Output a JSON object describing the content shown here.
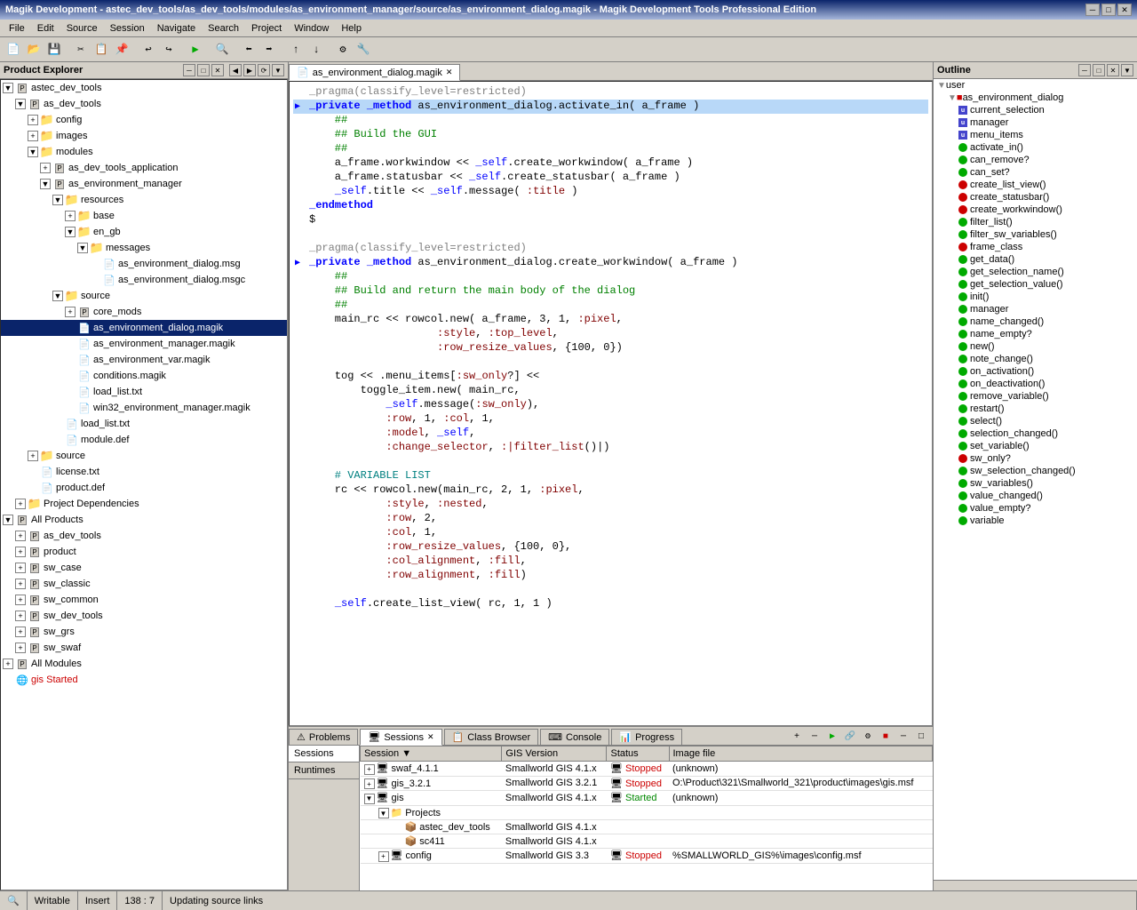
{
  "titleBar": {
    "title": "Magik Development - astec_dev_tools/as_dev_tools/modules/as_environment_manager/source/as_environment_dialog.magik - Magik Development Tools Professional Edition",
    "winBtns": [
      "─",
      "□",
      "✕"
    ]
  },
  "menuBar": {
    "items": [
      "File",
      "Edit",
      "Source",
      "Session",
      "Navigate",
      "Search",
      "Project",
      "Window",
      "Help"
    ]
  },
  "leftPanel": {
    "title": "Product Explorer",
    "tree": [
      {
        "label": "astec_dev_tools",
        "level": 0,
        "expand": "▼",
        "type": "pkg",
        "color": "#d4d0c8"
      },
      {
        "label": "as_dev_tools",
        "level": 1,
        "expand": "▼",
        "type": "pkg"
      },
      {
        "label": "config",
        "level": 2,
        "expand": "+",
        "type": "folder"
      },
      {
        "label": "images",
        "level": 2,
        "expand": "+",
        "type": "folder"
      },
      {
        "label": "modules",
        "level": 2,
        "expand": "▼",
        "type": "folder"
      },
      {
        "label": "as_dev_tools_application",
        "level": 3,
        "expand": "+",
        "type": "pkg"
      },
      {
        "label": "as_environment_manager",
        "level": 3,
        "expand": "▼",
        "type": "pkg"
      },
      {
        "label": "resources",
        "level": 4,
        "expand": "▼",
        "type": "folder"
      },
      {
        "label": "base",
        "level": 5,
        "expand": "+",
        "type": "folder"
      },
      {
        "label": "en_gb",
        "level": 5,
        "expand": "▼",
        "type": "folder"
      },
      {
        "label": "messages",
        "level": 6,
        "expand": "▼",
        "type": "folder"
      },
      {
        "label": "as_environment_dialog.msg",
        "level": 7,
        "expand": null,
        "type": "file"
      },
      {
        "label": "as_environment_dialog.msgc",
        "level": 7,
        "expand": null,
        "type": "file"
      },
      {
        "label": "source",
        "level": 4,
        "expand": "▼",
        "type": "folder"
      },
      {
        "label": "core_mods",
        "level": 5,
        "expand": "+",
        "type": "pkg"
      },
      {
        "label": "as_environment_dialog.magik",
        "level": 5,
        "expand": null,
        "type": "file",
        "selected": true
      },
      {
        "label": "as_environment_manager.magik",
        "level": 5,
        "expand": null,
        "type": "file"
      },
      {
        "label": "as_environment_var.magik",
        "level": 5,
        "expand": null,
        "type": "file"
      },
      {
        "label": "conditions.magik",
        "level": 5,
        "expand": null,
        "type": "file"
      },
      {
        "label": "load_list.txt",
        "level": 5,
        "expand": null,
        "type": "file"
      },
      {
        "label": "win32_environment_manager.magik",
        "level": 5,
        "expand": null,
        "type": "file"
      },
      {
        "label": "load_list.txt",
        "level": 4,
        "expand": null,
        "type": "file"
      },
      {
        "label": "module.def",
        "level": 4,
        "expand": null,
        "type": "file"
      },
      {
        "label": "source",
        "level": 2,
        "expand": "+",
        "type": "folder"
      },
      {
        "label": "license.txt",
        "level": 2,
        "expand": null,
        "type": "file"
      },
      {
        "label": "product.def",
        "level": 2,
        "expand": null,
        "type": "file"
      },
      {
        "label": "Project Dependencies",
        "level": 1,
        "expand": "+",
        "type": "folder"
      },
      {
        "label": "All Products",
        "level": 0,
        "expand": "▼",
        "type": "pkg"
      },
      {
        "label": "as_dev_tools",
        "level": 1,
        "expand": "+",
        "type": "pkg"
      },
      {
        "label": "product",
        "level": 1,
        "expand": "+",
        "type": "pkg"
      },
      {
        "label": "sw_case",
        "level": 1,
        "expand": "+",
        "type": "pkg"
      },
      {
        "label": "sw_classic",
        "level": 1,
        "expand": "+",
        "type": "pkg"
      },
      {
        "label": "sw_common",
        "level": 1,
        "expand": "+",
        "type": "pkg"
      },
      {
        "label": "sw_dev_tools",
        "level": 1,
        "expand": "+",
        "type": "pkg"
      },
      {
        "label": "sw_grs",
        "level": 1,
        "expand": "+",
        "type": "pkg"
      },
      {
        "label": "sw_swaf",
        "level": 1,
        "expand": "+",
        "type": "pkg"
      },
      {
        "label": "All Modules",
        "level": 0,
        "expand": "+",
        "type": "pkg"
      },
      {
        "label": "gis Started",
        "level": 0,
        "expand": null,
        "type": "gis"
      }
    ]
  },
  "editorTab": {
    "label": "as_environment_dialog.magik",
    "closeBtn": "✕"
  },
  "codeLines": [
    {
      "text": "_pragma(classify_level=restricted)",
      "type": "pragma",
      "arrow": false,
      "highlighted": false
    },
    {
      "text": "_private _method as_environment_dialog.activate_in( a_frame )",
      "type": "method",
      "arrow": true,
      "highlighted": true
    },
    {
      "text": "    ##",
      "type": "comment",
      "arrow": false,
      "highlighted": false
    },
    {
      "text": "    ## Build the GUI",
      "type": "comment",
      "arrow": false,
      "highlighted": false
    },
    {
      "text": "    ##",
      "type": "comment",
      "arrow": false,
      "highlighted": false
    },
    {
      "text": "    a_frame.workwindow << _self.create_workwindow( a_frame )",
      "type": "code",
      "arrow": false,
      "highlighted": false
    },
    {
      "text": "    a_frame.statusbar << _self.create_statusbar( a_frame )",
      "type": "code",
      "arrow": false,
      "highlighted": false
    },
    {
      "text": "    _self.title << _self.message( :title )",
      "type": "code",
      "arrow": false,
      "highlighted": false
    },
    {
      "text": "_endmethod",
      "type": "endmethod",
      "arrow": false,
      "highlighted": false
    },
    {
      "text": "$",
      "type": "code",
      "arrow": false,
      "highlighted": false
    },
    {
      "text": "",
      "type": "code",
      "arrow": false,
      "highlighted": false
    },
    {
      "text": "_pragma(classify_level=restricted)",
      "type": "pragma",
      "arrow": false,
      "highlighted": false
    },
    {
      "text": "_private _method as_environment_dialog.create_workwindow( a_frame )",
      "type": "method",
      "arrow": true,
      "highlighted": false
    },
    {
      "text": "    ##",
      "type": "comment",
      "arrow": false,
      "highlighted": false
    },
    {
      "text": "    ## Build and return the main body of the dialog",
      "type": "comment",
      "arrow": false,
      "highlighted": false
    },
    {
      "text": "    ##",
      "type": "comment",
      "arrow": false,
      "highlighted": false
    },
    {
      "text": "    main_rc << rowcol.new( a_frame, 3, 1, :pixel,",
      "type": "code",
      "arrow": false,
      "highlighted": false
    },
    {
      "text": "                    :style, :top_level,",
      "type": "code",
      "arrow": false,
      "highlighted": false
    },
    {
      "text": "                    :row_resize_values, {100, 0})",
      "type": "code",
      "arrow": false,
      "highlighted": false
    },
    {
      "text": "",
      "type": "code",
      "arrow": false,
      "highlighted": false
    },
    {
      "text": "    tog << .menu_items[:sw_only?] <<",
      "type": "code",
      "arrow": false,
      "highlighted": false
    },
    {
      "text": "        toggle_item.new( main_rc,",
      "type": "code",
      "arrow": false,
      "highlighted": false
    },
    {
      "text": "            _self.message(:sw_only),",
      "type": "code",
      "arrow": false,
      "highlighted": false
    },
    {
      "text": "            :row, 1, :col, 1,",
      "type": "code",
      "arrow": false,
      "highlighted": false
    },
    {
      "text": "            :model, _self,",
      "type": "code",
      "arrow": false,
      "highlighted": false
    },
    {
      "text": "            :change_selector, :|filter_list()|)",
      "type": "code",
      "arrow": false,
      "highlighted": false
    },
    {
      "text": "",
      "type": "code",
      "arrow": false,
      "highlighted": false
    },
    {
      "text": "    # VARIABLE LIST",
      "type": "comment2",
      "arrow": false,
      "highlighted": false
    },
    {
      "text": "    rc << rowcol.new(main_rc, 2, 1, :pixel,",
      "type": "code",
      "arrow": false,
      "highlighted": false
    },
    {
      "text": "            :style, :nested,",
      "type": "code",
      "arrow": false,
      "highlighted": false
    },
    {
      "text": "            :row, 2,",
      "type": "code",
      "arrow": false,
      "highlighted": false
    },
    {
      "text": "            :col, 1,",
      "type": "code",
      "arrow": false,
      "highlighted": false
    },
    {
      "text": "            :row_resize_values, {100, 0},",
      "type": "code",
      "arrow": false,
      "highlighted": false
    },
    {
      "text": "            :col_alignment, :fill,",
      "type": "code",
      "arrow": false,
      "highlighted": false
    },
    {
      "text": "            :row_alignment, :fill)",
      "type": "code",
      "arrow": false,
      "highlighted": false
    },
    {
      "text": "",
      "type": "code",
      "arrow": false,
      "highlighted": false
    },
    {
      "text": "    _self.create_list_view( rc, 1, 1 )",
      "type": "code",
      "arrow": false,
      "highlighted": false
    }
  ],
  "bottomTabs": [
    {
      "label": "Problems",
      "icon": "⚠",
      "active": false
    },
    {
      "label": "Sessions",
      "icon": "🖥",
      "active": true
    },
    {
      "label": "Class Browser",
      "icon": "📋",
      "active": false
    },
    {
      "label": "Console",
      "icon": "⌨",
      "active": false
    },
    {
      "label": "Progress",
      "icon": "📊",
      "active": false
    }
  ],
  "sessionsTable": {
    "columns": [
      "Session",
      "GIS Version",
      "Status",
      "Image file"
    ],
    "rows": [
      {
        "indent": 0,
        "expand": "+",
        "label": "swaf_4.1.1",
        "gisVersion": "Smallworld GIS 4.1.x",
        "status": "Stopped",
        "imageFile": "(unknown)",
        "type": "session"
      },
      {
        "indent": 0,
        "expand": "+",
        "label": "gis_3.2.1",
        "gisVersion": "Smallworld GIS 3.2.1",
        "status": "Stopped",
        "imageFile": "O:\\Product\\321\\Smallworld_321\\product\\images\\gis.msf",
        "type": "session"
      },
      {
        "indent": 0,
        "expand": "▼",
        "label": "gis",
        "gisVersion": "Smallworld GIS 4.1.x",
        "status": "Started",
        "imageFile": "(unknown)",
        "type": "session"
      },
      {
        "indent": 1,
        "expand": "▼",
        "label": "Projects",
        "gisVersion": "",
        "status": "",
        "imageFile": "",
        "type": "folder"
      },
      {
        "indent": 2,
        "expand": null,
        "label": "astec_dev_tools",
        "gisVersion": "Smallworld GIS 4.1.x",
        "status": "",
        "imageFile": "",
        "type": "project"
      },
      {
        "indent": 2,
        "expand": null,
        "label": "sc411",
        "gisVersion": "Smallworld GIS 4.1.x",
        "status": "",
        "imageFile": "",
        "type": "project"
      },
      {
        "indent": 1,
        "expand": "+",
        "label": "config",
        "gisVersion": "Smallworld GIS 3.3",
        "status": "Stopped",
        "imageFile": "%SMALLWORLD_GIS%\\images\\config.msf",
        "type": "session"
      }
    ]
  },
  "sideTabs": [
    "Sessions",
    "Runtimes"
  ],
  "outline": {
    "title": "Outline",
    "root": "user",
    "rootChild": "as_environment_dialog",
    "items": [
      {
        "label": "current_selection",
        "dot": "blue",
        "type": "u"
      },
      {
        "label": "manager",
        "dot": "blue",
        "type": "u"
      },
      {
        "label": "menu_items",
        "dot": "blue",
        "type": "u"
      },
      {
        "label": "activate_in()",
        "dot": "green"
      },
      {
        "label": "can_remove?",
        "dot": "green"
      },
      {
        "label": "can_set?",
        "dot": "green"
      },
      {
        "label": "create_list_view()",
        "dot": "red"
      },
      {
        "label": "create_statusbar()",
        "dot": "red"
      },
      {
        "label": "create_workwindow()",
        "dot": "red"
      },
      {
        "label": "filter_list()",
        "dot": "green"
      },
      {
        "label": "filter_sw_variables()",
        "dot": "green"
      },
      {
        "label": "frame_class",
        "dot": "red"
      },
      {
        "label": "get_data()",
        "dot": "green"
      },
      {
        "label": "get_selection_name()",
        "dot": "green"
      },
      {
        "label": "get_selection_value()",
        "dot": "green"
      },
      {
        "label": "init()",
        "dot": "green"
      },
      {
        "label": "manager",
        "dot": "green"
      },
      {
        "label": "name_changed()",
        "dot": "green"
      },
      {
        "label": "name_empty?",
        "dot": "green"
      },
      {
        "label": "new()",
        "dot": "green"
      },
      {
        "label": "note_change()",
        "dot": "green"
      },
      {
        "label": "on_activation()",
        "dot": "green"
      },
      {
        "label": "on_deactivation()",
        "dot": "green"
      },
      {
        "label": "remove_variable()",
        "dot": "green"
      },
      {
        "label": "restart()",
        "dot": "green"
      },
      {
        "label": "select()",
        "dot": "green"
      },
      {
        "label": "selection_changed()",
        "dot": "green"
      },
      {
        "label": "set_variable()",
        "dot": "green"
      },
      {
        "label": "sw_only?",
        "dot": "red"
      },
      {
        "label": "sw_selection_changed()",
        "dot": "green"
      },
      {
        "label": "sw_variables()",
        "dot": "green"
      },
      {
        "label": "value_changed()",
        "dot": "green"
      },
      {
        "label": "value_empty?",
        "dot": "green"
      },
      {
        "label": "variable",
        "dot": "green"
      }
    ]
  },
  "statusBar": {
    "writable": "Writable",
    "insertMode": "Insert",
    "position": "138 : 7",
    "status": "Updating source links"
  }
}
